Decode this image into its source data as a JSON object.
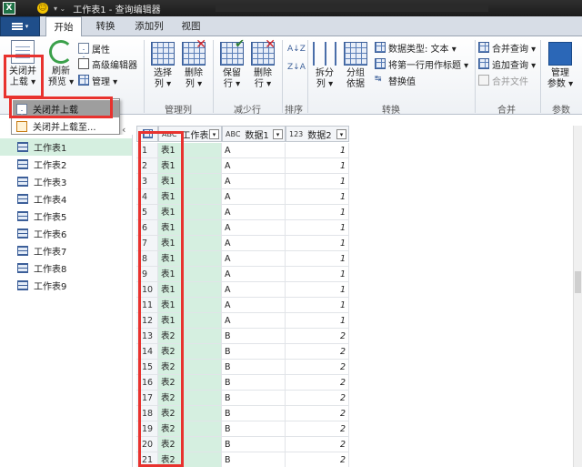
{
  "titlebar": {
    "app_icon": "X",
    "title": "工作表1 - 查询编辑器"
  },
  "tabs": [
    {
      "label": "开始",
      "active": true
    },
    {
      "label": "转换",
      "active": false
    },
    {
      "label": "添加列",
      "active": false
    },
    {
      "label": "视图",
      "active": false
    }
  ],
  "ribbon": {
    "close_load": "关闭并\n上载",
    "close_load_line1": "关闭并",
    "close_load_line2": "上载 ▾",
    "refresh_line1": "刷新",
    "refresh_line2": "预览 ▾",
    "properties": "属性",
    "advanced_editor": "高级编辑器",
    "manage": "管理 ▾",
    "choose_cols_line1": "选择",
    "choose_cols_line2": "列 ▾",
    "remove_cols_line1": "删除",
    "remove_cols_line2": "列 ▾",
    "keep_rows_line1": "保留",
    "keep_rows_line2": "行 ▾",
    "remove_rows_line1": "删除",
    "remove_rows_line2": "行 ▾",
    "split_line1": "拆分",
    "split_line2": "列 ▾",
    "group_line1": "分组",
    "group_line2": "依据",
    "data_type": "数据类型: 文本 ▾",
    "first_row_header": "将第一行用作标题 ▾",
    "replace_values": "替换值",
    "merge_queries": "合并查询 ▾",
    "append_queries": "追加查询 ▾",
    "combine_files": "合并文件",
    "manage_params_line1": "管理",
    "manage_params_line2": "参数 ▾",
    "group_manage_cols": "管理列",
    "group_reduce_rows": "减少行",
    "group_sort": "排序",
    "group_transform": "转换",
    "group_combine": "合并",
    "group_params": "参数"
  },
  "menu": {
    "items": [
      {
        "label": "关闭并上载"
      },
      {
        "label": "关闭并上载至..."
      }
    ]
  },
  "queries": [
    "工作表1",
    "工作表2",
    "工作表3",
    "工作表4",
    "工作表5",
    "工作表6",
    "工作表7",
    "工作表8",
    "工作表9"
  ],
  "grid": {
    "columns": [
      {
        "type": "ABC",
        "name": "工作表"
      },
      {
        "type": "ABC",
        "name": "数据1"
      },
      {
        "type": "123",
        "name": "数据2"
      }
    ],
    "rows": [
      [
        "1",
        "表1",
        "A",
        "1"
      ],
      [
        "2",
        "表1",
        "A",
        "1"
      ],
      [
        "3",
        "表1",
        "A",
        "1"
      ],
      [
        "4",
        "表1",
        "A",
        "1"
      ],
      [
        "5",
        "表1",
        "A",
        "1"
      ],
      [
        "6",
        "表1",
        "A",
        "1"
      ],
      [
        "7",
        "表1",
        "A",
        "1"
      ],
      [
        "8",
        "表1",
        "A",
        "1"
      ],
      [
        "9",
        "表1",
        "A",
        "1"
      ],
      [
        "10",
        "表1",
        "A",
        "1"
      ],
      [
        "11",
        "表1",
        "A",
        "1"
      ],
      [
        "12",
        "表1",
        "A",
        "1"
      ],
      [
        "13",
        "表2",
        "B",
        "2"
      ],
      [
        "14",
        "表2",
        "B",
        "2"
      ],
      [
        "15",
        "表2",
        "B",
        "2"
      ],
      [
        "16",
        "表2",
        "B",
        "2"
      ],
      [
        "17",
        "表2",
        "B",
        "2"
      ],
      [
        "18",
        "表2",
        "B",
        "2"
      ],
      [
        "19",
        "表2",
        "B",
        "2"
      ],
      [
        "20",
        "表2",
        "B",
        "2"
      ],
      [
        "21",
        "表2",
        "B",
        "2"
      ]
    ]
  },
  "colors": {
    "highlight": "#e8322e",
    "selection": "#d5efe0",
    "file_tab": "#1f4e8a"
  }
}
